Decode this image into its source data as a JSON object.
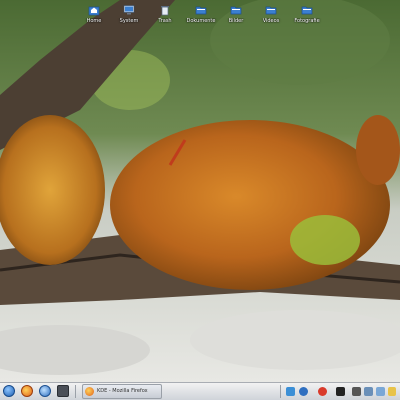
{
  "desktop": {
    "icons": [
      {
        "label": "Home",
        "icon": "home-folder-icon"
      },
      {
        "label": "System",
        "icon": "computer-icon"
      },
      {
        "label": "Trash",
        "icon": "trash-icon"
      },
      {
        "label": "Dokumente",
        "icon": "folder-icon"
      },
      {
        "label": "Bilder",
        "icon": "folder-icon"
      },
      {
        "label": "Videos",
        "icon": "folder-icon"
      },
      {
        "label": "Fotografie",
        "icon": "folder-icon"
      }
    ]
  },
  "taskbar": {
    "task_label": "KDE - Mozilla Firefox",
    "colors": {
      "bar_top": "#f2f2f2",
      "bar_bottom": "#cfd3d9",
      "accent": "#2f6fc0"
    }
  }
}
